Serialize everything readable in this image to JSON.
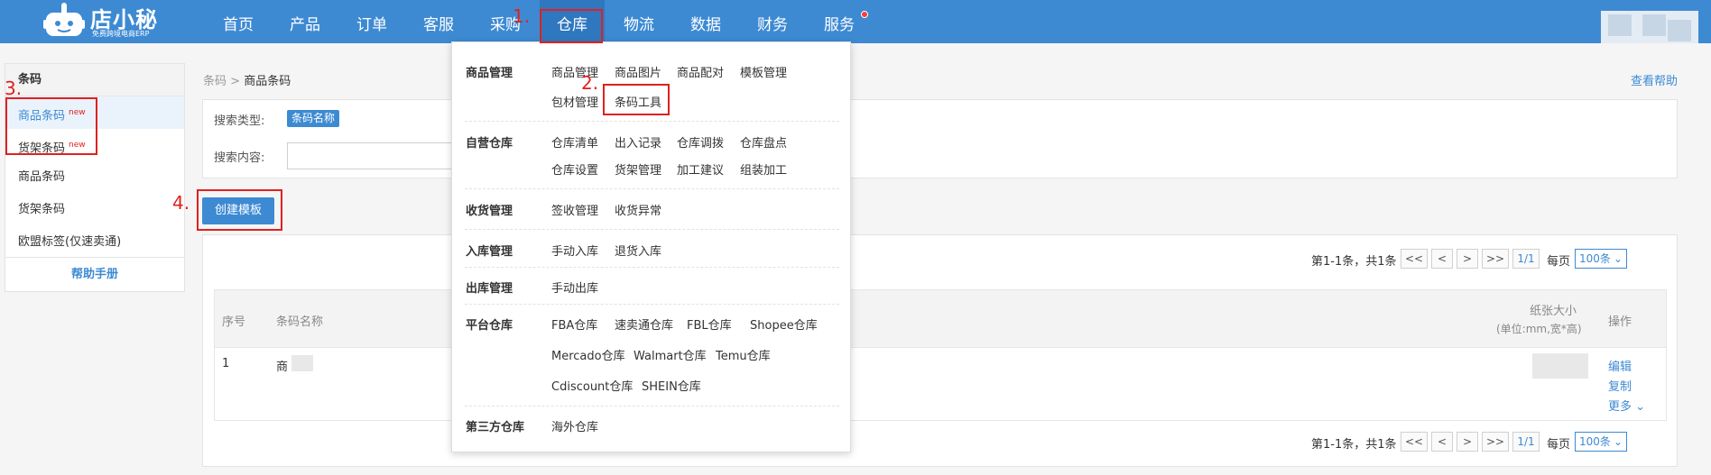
{
  "brand": {
    "title": "店小秘",
    "subtitle": "免费跨境电商ERP"
  },
  "nav": {
    "items": [
      {
        "label": "首页"
      },
      {
        "label": "产品"
      },
      {
        "label": "订单"
      },
      {
        "label": "客服"
      },
      {
        "label": "采购"
      },
      {
        "label": "仓库"
      },
      {
        "label": "物流"
      },
      {
        "label": "数据"
      },
      {
        "label": "财务"
      },
      {
        "label": "服务"
      }
    ],
    "active": "仓库"
  },
  "colors": {
    "primary": "#3d8ad3",
    "annotation": "#e02020"
  },
  "sidebar": {
    "header": "条码",
    "items": [
      {
        "label": "商品条码",
        "badge": "new"
      },
      {
        "label": "货架条码",
        "badge": "new"
      },
      {
        "label": "商品条码"
      },
      {
        "label": "货架条码"
      },
      {
        "label": "欧盟标签(仅速卖通)"
      }
    ],
    "help": "帮助手册"
  },
  "breadcrumb": {
    "parent": "条码",
    "separator": ">",
    "current": "商品条码"
  },
  "help_link": "查看帮助",
  "search": {
    "type_label": "搜索类型:",
    "type_value": "条码名称",
    "content_label": "搜索内容:"
  },
  "create_button": "创建模板",
  "pagination": {
    "summary": "第1-1条，共1条",
    "first": "<<",
    "prev": "<",
    "next": ">",
    "last": ">>",
    "page": "1/1",
    "per_page_label": "每页",
    "per_page_value": "100条"
  },
  "table": {
    "headers": {
      "index": "序号",
      "name": "条码名称",
      "paper_size": "纸张大小",
      "paper_size_unit": "(单位:mm,宽*高)",
      "ops": "操作"
    },
    "rows": [
      {
        "index": "1",
        "name": "商"
      }
    ],
    "ops": {
      "edit": "编辑",
      "copy": "复制",
      "more": "更多"
    }
  },
  "dropdown": {
    "sections": [
      {
        "title": "商品管理",
        "items": [
          "商品管理",
          "商品图片",
          "商品配对",
          "模板管理",
          "包材管理",
          "条码工具"
        ]
      },
      {
        "title": "自营仓库",
        "items": [
          "仓库清单",
          "出入记录",
          "仓库调拨",
          "仓库盘点",
          "仓库设置",
          "货架管理",
          "加工建议",
          "组装加工"
        ]
      },
      {
        "title": "收货管理",
        "items": [
          "签收管理",
          "收货异常"
        ]
      },
      {
        "title": "入库管理",
        "items": [
          "手动入库",
          "退货入库"
        ]
      },
      {
        "title": "出库管理",
        "items": [
          "手动出库"
        ]
      },
      {
        "title": "平台仓库",
        "items": [
          "FBA仓库",
          "速卖通仓库",
          "FBL仓库",
          "Shopee仓库",
          "Mercado仓库",
          "Walmart仓库",
          "Temu仓库",
          "Cdiscount仓库",
          "SHEIN仓库"
        ]
      },
      {
        "title": "第三方仓库",
        "items": [
          "海外仓库"
        ]
      }
    ]
  },
  "annotations": [
    "1.",
    "2.",
    "3.",
    "4."
  ]
}
